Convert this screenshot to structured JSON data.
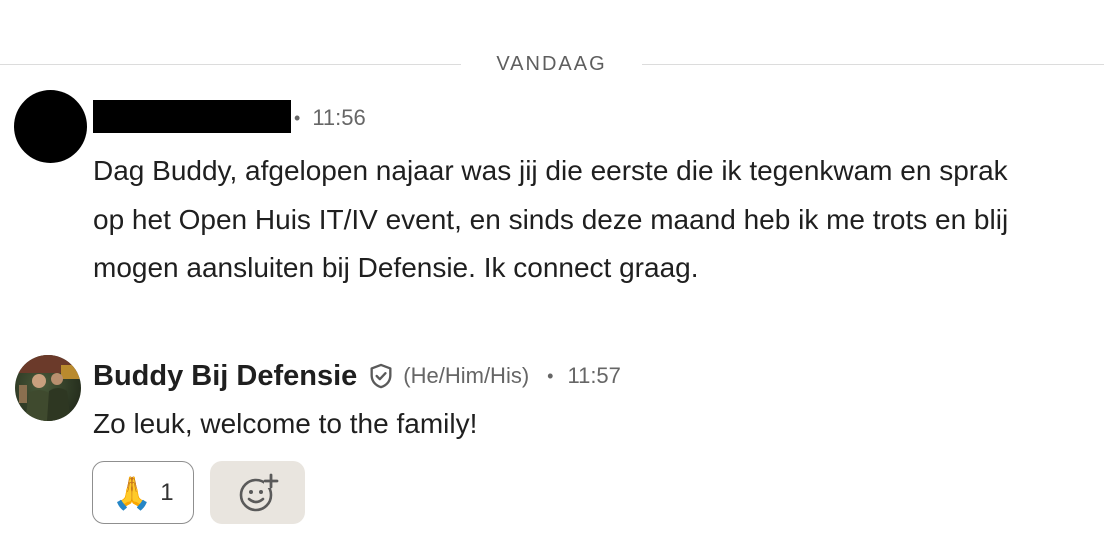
{
  "divider": {
    "label": "VANDAAG"
  },
  "message1": {
    "sender_redacted": true,
    "separator": "•",
    "time": "11:56",
    "text": "Dag Buddy, afgelopen najaar was jij die eerste die ik tegenkwam en sprak op het Open Huis IT/IV event, en sinds deze maand heb ik me trots en blij mogen aansluiten bij Defensie. Ik connect graag."
  },
  "message2": {
    "sender": "Buddy Bij Defensie",
    "verified_icon": "shield-check-icon",
    "pronouns": "(He/Him/His)",
    "separator": "•",
    "time": "11:57",
    "text": "Zo leuk, welcome to the family!"
  },
  "reactions": {
    "items": [
      {
        "emoji": "🙏",
        "count": "1"
      }
    ],
    "add_icon": "add-reaction-icon"
  },
  "colors": {
    "text": "#1f1f1f",
    "muted": "#666666",
    "divider_line": "#dcdcdc",
    "add_reaction_bg": "#e9e5df"
  }
}
